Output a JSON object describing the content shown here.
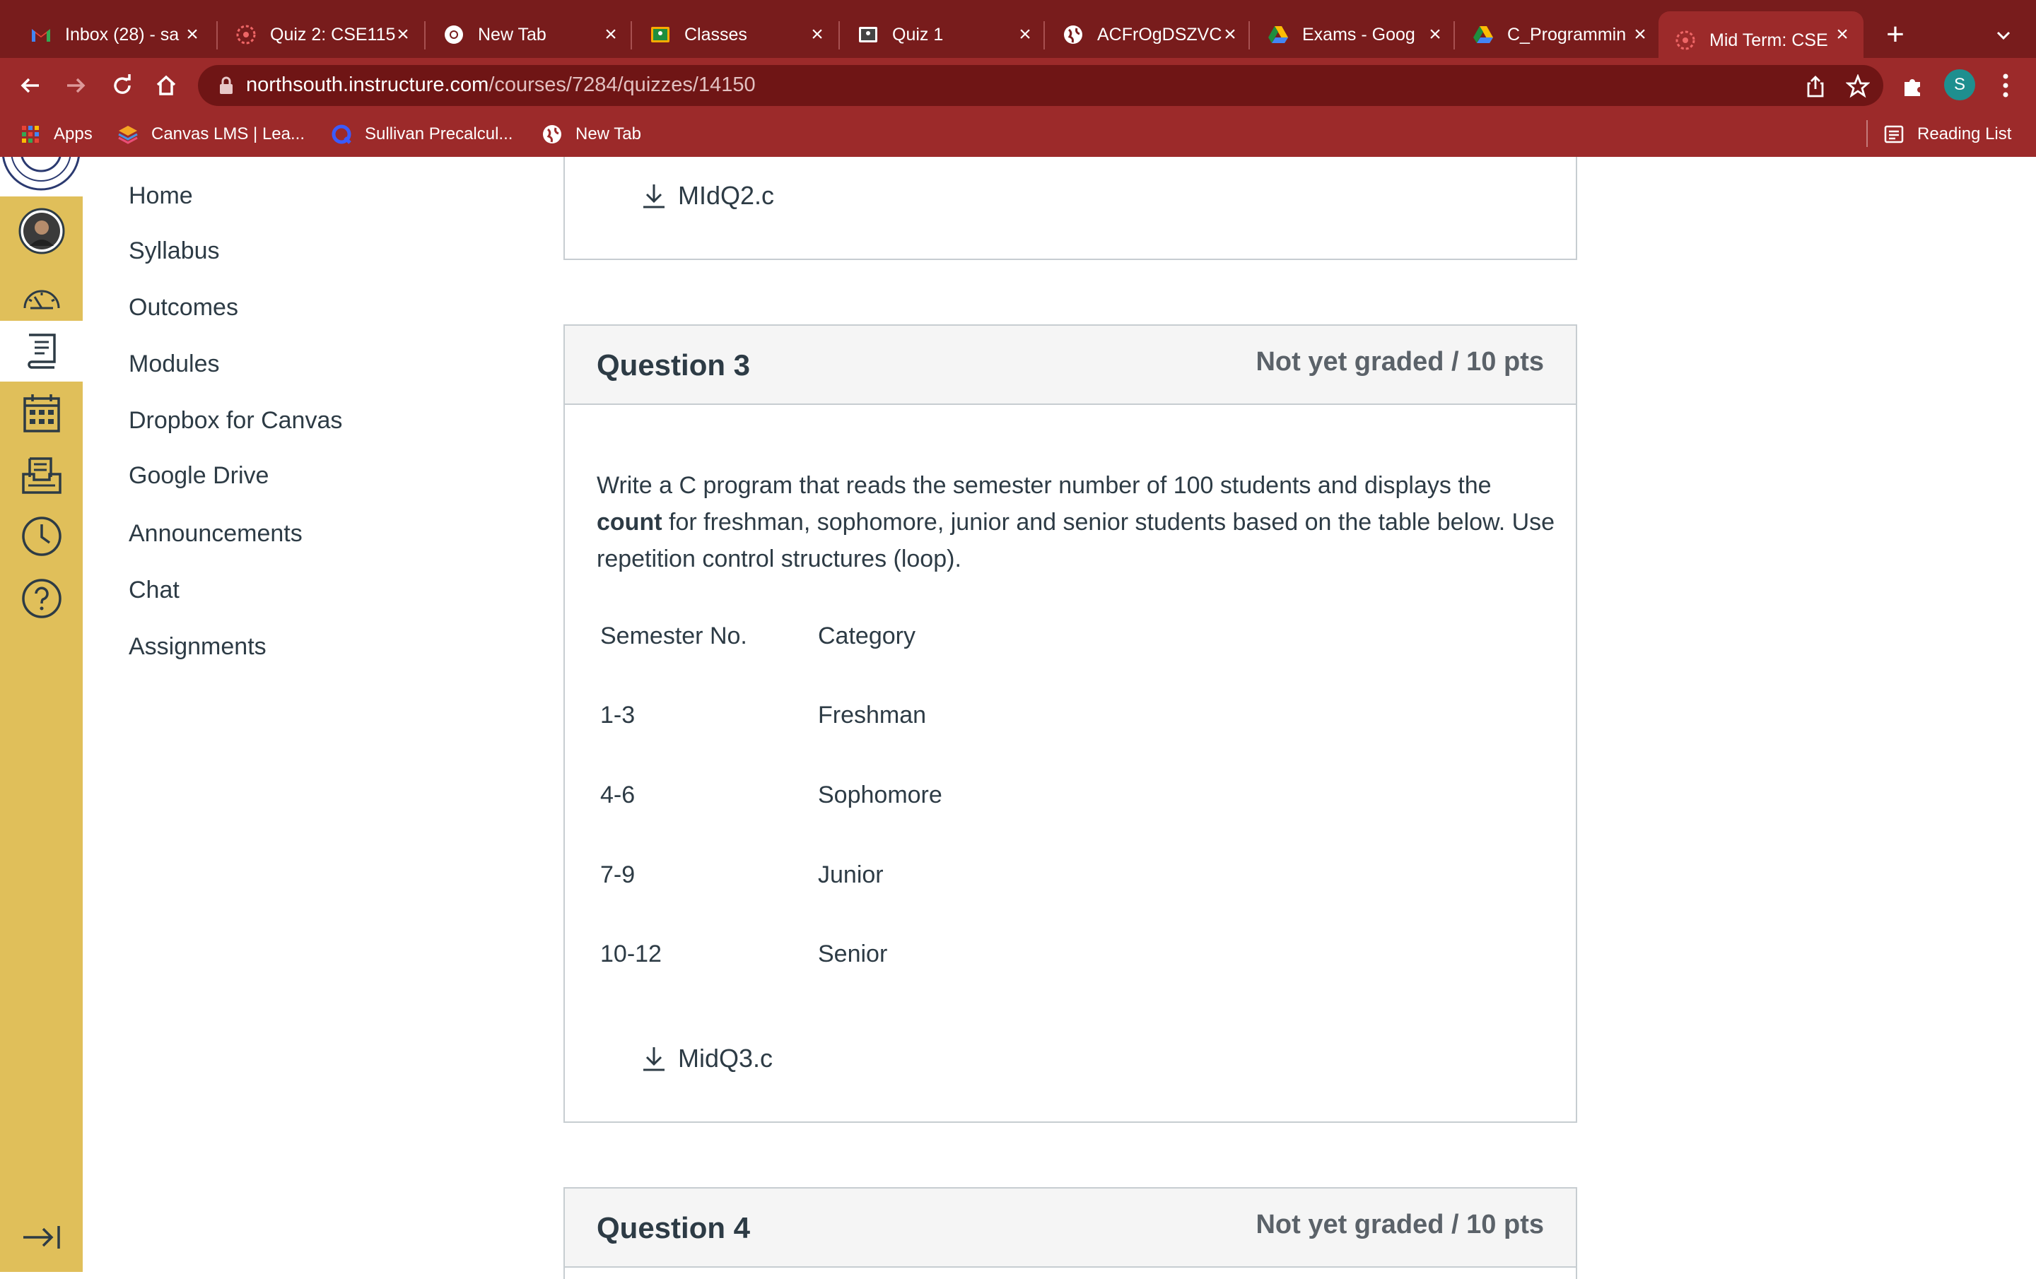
{
  "browser": {
    "tabs": [
      {
        "label": "Inbox (28) - sa",
        "icon": "gmail-icon"
      },
      {
        "label": "Quiz 2: CSE115",
        "icon": "canvas-icon"
      },
      {
        "label": "New Tab",
        "icon": "chrome-icon"
      },
      {
        "label": "Classes",
        "icon": "classroom-icon"
      },
      {
        "label": "Quiz 1",
        "icon": "classroom-icon"
      },
      {
        "label": "ACFrOgDSZVC",
        "icon": "globe-icon"
      },
      {
        "label": "Exams - Goog",
        "icon": "drive-icon"
      },
      {
        "label": "C_Programmin",
        "icon": "drive-icon"
      },
      {
        "label": "Mid Term: CSE",
        "icon": "canvas-icon",
        "active": true
      }
    ],
    "url_host": "northsouth.instructure.com",
    "url_path": "/courses/7284/quizzes/14150",
    "profile_initial": "S",
    "bookmarks": [
      {
        "label": "Apps"
      },
      {
        "label": "Canvas LMS | Lea..."
      },
      {
        "label": "Sullivan Precalcul..."
      },
      {
        "label": "New Tab"
      }
    ],
    "reading_list": "Reading List"
  },
  "course_nav": [
    "Home",
    "Syllabus",
    "Outcomes",
    "Modules",
    "Dropbox for Canvas",
    "Google Drive",
    "Announcements",
    "Chat",
    "Assignments"
  ],
  "quiz": {
    "prev_attachment": "MIdQ2.c",
    "question3": {
      "title": "Question 3",
      "points": "Not yet graded / 10 pts",
      "text_part1": "Write a C program that reads the semester number of 100 students and displays the ",
      "text_bold": "count",
      "text_part2": " for freshman, sophomore, junior and senior students based on the table below. Use repetition control structures (loop).",
      "table": [
        {
          "semester": "Semester No.",
          "category": "Category"
        },
        {
          "semester": "1-3",
          "category": "Freshman"
        },
        {
          "semester": "4-6",
          "category": "Sophomore"
        },
        {
          "semester": "7-9",
          "category": "Junior"
        },
        {
          "semester": "10-12",
          "category": "Senior"
        }
      ],
      "attachment": "MidQ3.c"
    },
    "question4": {
      "title": "Question 4",
      "points": "Not yet graded / 10 pts"
    }
  },
  "colors": {
    "tabbar": "#781c1c",
    "toolbar": "#9c2a2a",
    "global_nav": "#e0bf5a",
    "text": "#2d3b45"
  }
}
